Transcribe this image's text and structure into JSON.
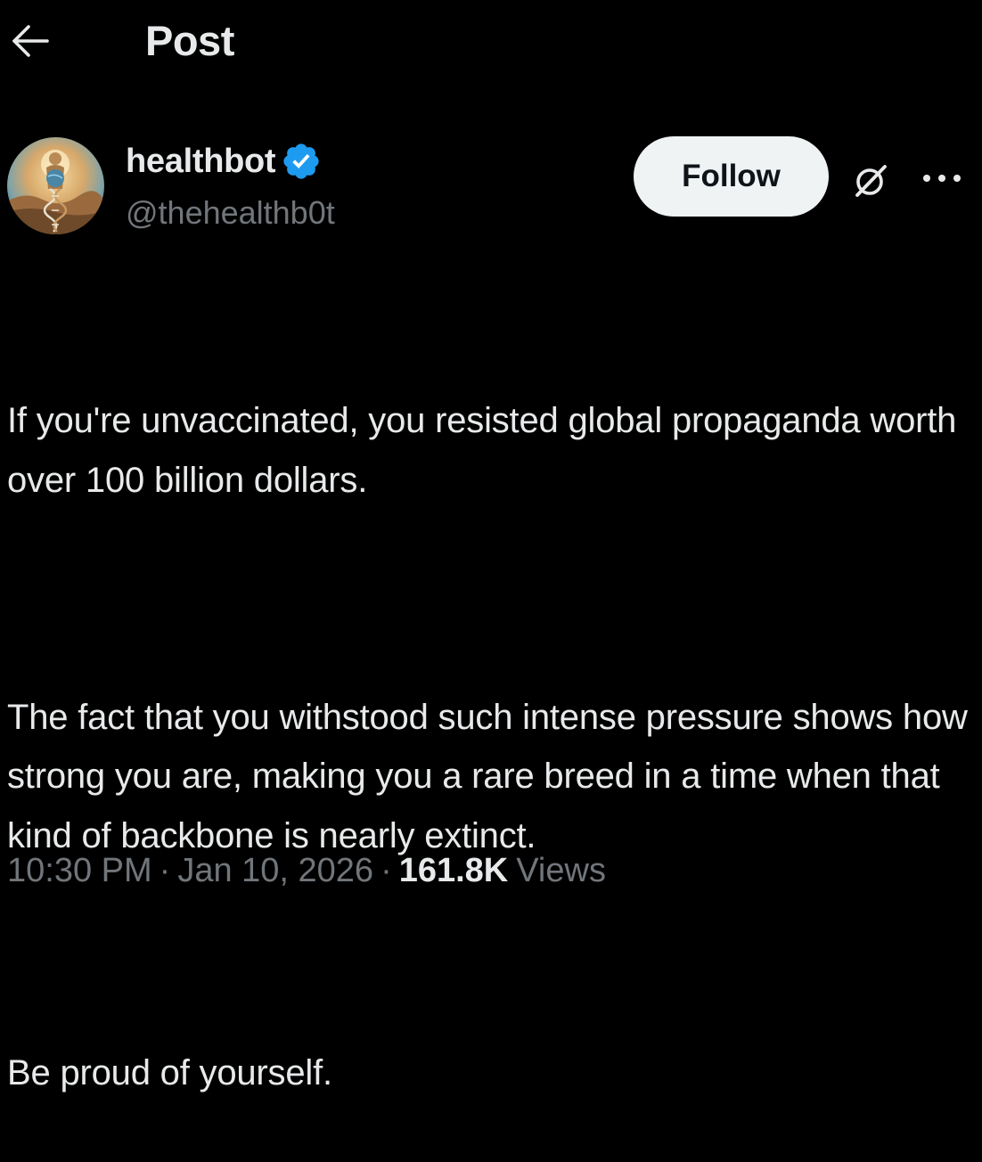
{
  "header": {
    "back_icon": "arrow-left-icon",
    "title": "Post"
  },
  "author": {
    "display_name": "healthbot",
    "verified_icon": "verified-badge-icon",
    "verified_color": "#1d9bf0",
    "handle": "@thehealthb0t",
    "follow_label": "Follow",
    "grok_icon": "grok-icon",
    "more_icon": "more-horizontal-icon"
  },
  "post": {
    "paragraphs": [
      "If you're unvaccinated, you resisted global propaganda worth over 100 billion dollars.",
      "The fact that you withstood such intense pressure shows how strong you are, making you a rare breed in a time when that kind of backbone is nearly extinct.",
      "Be proud of yourself."
    ]
  },
  "meta": {
    "time": "10:30 PM",
    "separator": "·",
    "date": "Jan 10, 2026",
    "views_count": "161.8K",
    "views_label": "Views"
  },
  "colors": {
    "background": "#000000",
    "primary_text": "#e7e9ea",
    "secondary_text": "#71767b",
    "follow_bg": "#eff3f4",
    "follow_text": "#0f1419",
    "accent": "#1d9bf0"
  }
}
